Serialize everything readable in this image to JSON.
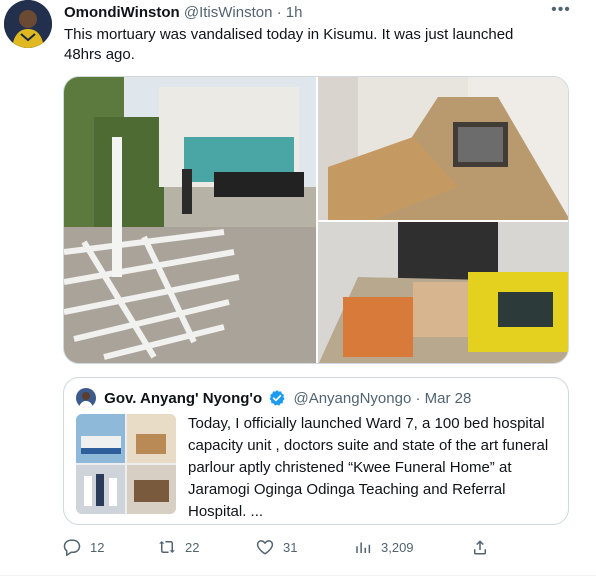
{
  "tweet": {
    "display_name": "OmondiWinston",
    "handle": "@ItisWinston",
    "separator": "·",
    "time": "1h",
    "text": "This mortuary was vandalised today in Kisumu. It was just launched 48hrs ago.",
    "media": [
      {
        "icon": "photo-vandalised-gate"
      },
      {
        "icon": "photo-damaged-corridor"
      },
      {
        "icon": "photo-vandalised-room"
      }
    ]
  },
  "quote": {
    "display_name": "Gov. Anyang' Nyong'o",
    "handle": "@AnyangNyongo",
    "separator": "·",
    "date": "Mar 28",
    "text": "Today, I officially launched Ward 7, a 100 bed hospital capacity unit , doctors suite and state of the art funeral parlour  aptly christened “Kwee Funeral Home” at Jaramogi Oginga Odinga Teaching and Referral Hospital. ..."
  },
  "actions": {
    "replies": "12",
    "retweets": "22",
    "likes": "31",
    "views": "3,209"
  },
  "colors": {
    "text": "#0f1419",
    "secondary": "#536471",
    "border": "#cfd9de",
    "verified": "#1d9bf0"
  }
}
